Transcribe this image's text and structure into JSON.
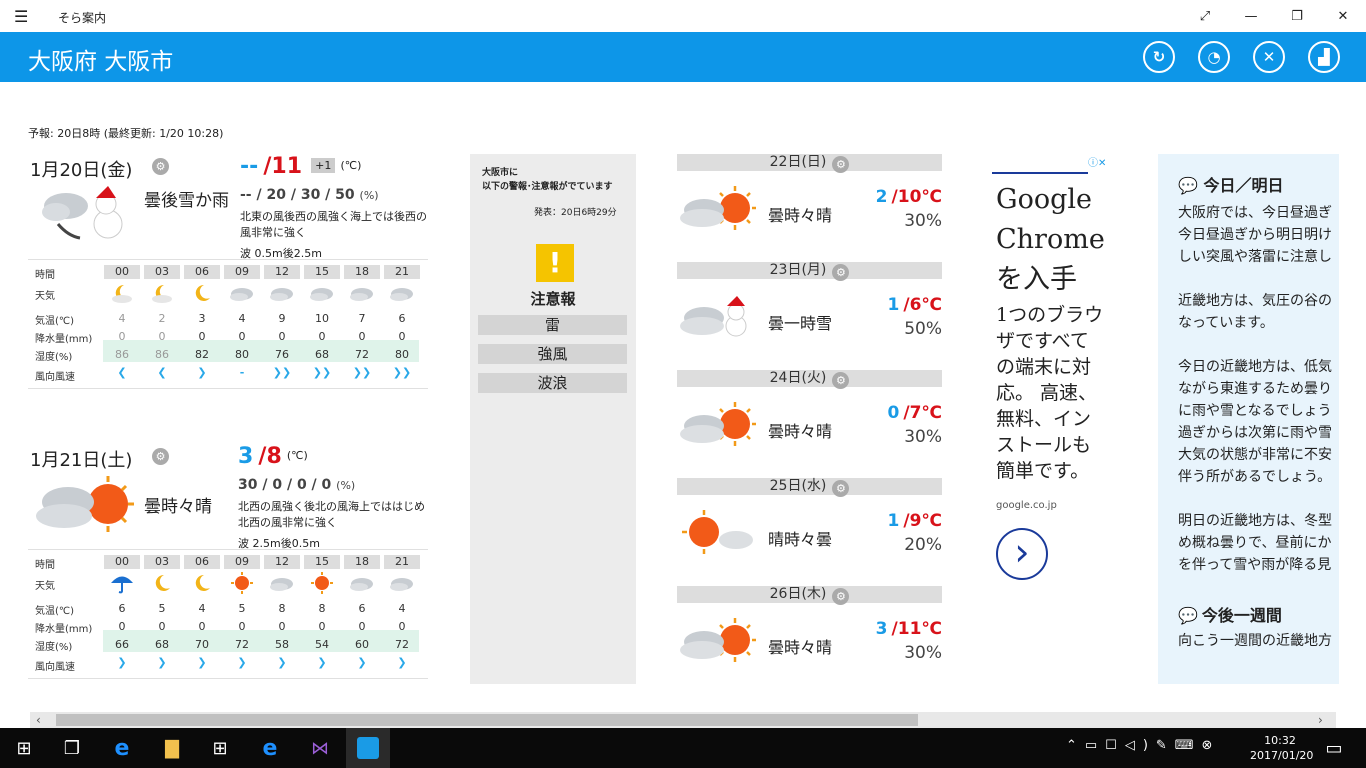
{
  "window": {
    "title": "そら案内",
    "controls": [
      "⤢",
      "—",
      "❐",
      "✕"
    ]
  },
  "header": {
    "location": "大阪府 大阪市",
    "icons": [
      "refresh-icon",
      "timer-icon",
      "satellite-icon",
      "chart-icon"
    ]
  },
  "forecast_note": "予報: 20日8時 (最終更新: 1/20 10:28)",
  "today": {
    "date": "1月20日(金)",
    "min": "--",
    "slash": "/",
    "max": "11",
    "diff": "+1",
    "unit": "(℃)",
    "desc": "曇後雪か雨",
    "precip": "-- / 20 / 30 / 50",
    "precip_unit": "(%)",
    "wind": "北東の風後西の風強く海上では後西の風非常に強く",
    "wave": "波 0.5m後2.5m",
    "hours": [
      "00",
      "03",
      "06",
      "09",
      "12",
      "15",
      "18",
      "21"
    ],
    "weather_icons": [
      "moon-cloud",
      "moon-cloud",
      "moon",
      "cloud",
      "cloud",
      "cloud",
      "cloud",
      "cloud"
    ],
    "temp": [
      "4",
      "2",
      "3",
      "4",
      "9",
      "10",
      "7",
      "6"
    ],
    "rain": [
      "0",
      "0",
      "0",
      "0",
      "0",
      "0",
      "0",
      "0"
    ],
    "humidity": [
      "86",
      "86",
      "82",
      "80",
      "76",
      "68",
      "72",
      "80"
    ],
    "wind_dirs": [
      "light",
      "light",
      "medium",
      "-",
      "strong",
      "strong",
      "strong",
      "strong"
    ],
    "wind_placeholder": "-"
  },
  "tomorrow": {
    "date": "1月21日(土)",
    "min": "3",
    "slash": "/",
    "max": "8",
    "unit": "(℃)",
    "desc": "曇時々晴",
    "precip": "30 / 0 / 0 / 0",
    "precip_unit": "(%)",
    "wind": "北西の風強く後北の風海上でははじめ北西の風非常に強く",
    "wave": "波 2.5m後0.5m",
    "hours": [
      "00",
      "03",
      "06",
      "09",
      "12",
      "15",
      "18",
      "21"
    ],
    "weather_icons": [
      "umbrella",
      "moon",
      "moon",
      "sun",
      "cloud",
      "sun",
      "cloud",
      "cloud"
    ],
    "temp": [
      "6",
      "5",
      "4",
      "5",
      "8",
      "8",
      "6",
      "4"
    ],
    "rain": [
      "0",
      "0",
      "0",
      "0",
      "0",
      "0",
      "0",
      "0"
    ],
    "humidity": [
      "66",
      "68",
      "70",
      "72",
      "58",
      "54",
      "60",
      "72"
    ],
    "wind_dirs": [
      "medium",
      "medium",
      "medium",
      "medium",
      "medium",
      "medium",
      "medium",
      "medium"
    ]
  },
  "grid_labels": {
    "time": "時間",
    "weather": "天気",
    "temp": "気温(℃)",
    "rain": "降水量(mm)",
    "humidity": "湿度(%)",
    "wind": "風向風速"
  },
  "warning": {
    "title": "大阪市に\n以下の警報･注意報がでています",
    "line1": "大阪市に",
    "line2": "以下の警報･注意報がでています",
    "issued": "発表：20日6時29分",
    "level": "注意報",
    "items": [
      "雷",
      "強風",
      "波浪"
    ]
  },
  "week": [
    {
      "date": "22日(日)",
      "desc": "曇時々晴",
      "min": "2",
      "max": "10",
      "unit": "℃",
      "pop": "30%",
      "icon": "cloud-sun"
    },
    {
      "date": "23日(月)",
      "desc": "曇一時雪",
      "min": "1",
      "max": "6",
      "unit": "℃",
      "pop": "50%",
      "icon": "cloud-snow"
    },
    {
      "date": "24日(火)",
      "desc": "曇時々晴",
      "min": "0",
      "max": "7",
      "unit": "℃",
      "pop": "30%",
      "icon": "cloud-sun"
    },
    {
      "date": "25日(水)",
      "desc": "晴時々曇",
      "min": "1",
      "max": "9",
      "unit": "℃",
      "pop": "20%",
      "icon": "sun-cloud"
    },
    {
      "date": "26日(木)",
      "desc": "曇時々晴",
      "min": "3",
      "max": "11",
      "unit": "℃",
      "pop": "30%",
      "icon": "cloud-sun"
    }
  ],
  "ad": {
    "line1": "Google",
    "line2": "Chrome",
    "line3": "を入手",
    "body": [
      "1つのブラウ",
      "ザですべて",
      "の端末に対",
      "応。 高速、",
      "無料、イン",
      "ストールも",
      "簡単です。"
    ],
    "domain": "google.co.jp",
    "arrow": "›"
  },
  "right_panel": {
    "head1": "今日／明日",
    "paras": [
      [
        "大阪府では、今日昼過ぎ",
        "今日昼過ぎから明日明け",
        "しい突風や落雷に注意し"
      ],
      [
        "近畿地方は、気圧の谷の",
        "なっています。"
      ],
      [
        "今日の近畿地方は、低気",
        "ながら東進するため曇り",
        "に雨や雪となるでしょう",
        "過ぎからは次第に雨や雪",
        "大気の状態が非常に不安",
        "伴う所があるでしょう。"
      ],
      [
        "明日の近畿地方は、冬型",
        "め概ね曇りで、昼前にか",
        "を伴って雪や雨が降る見"
      ]
    ],
    "head2": "今後一週間",
    "tail": "向こう一週間の近畿地方"
  },
  "taskbar": {
    "time": "10:32",
    "date": "2017/01/20",
    "apps": [
      "start",
      "task-view",
      "edge",
      "explorer",
      "store",
      "ie",
      "visual-studio",
      "sora-annai"
    ]
  }
}
